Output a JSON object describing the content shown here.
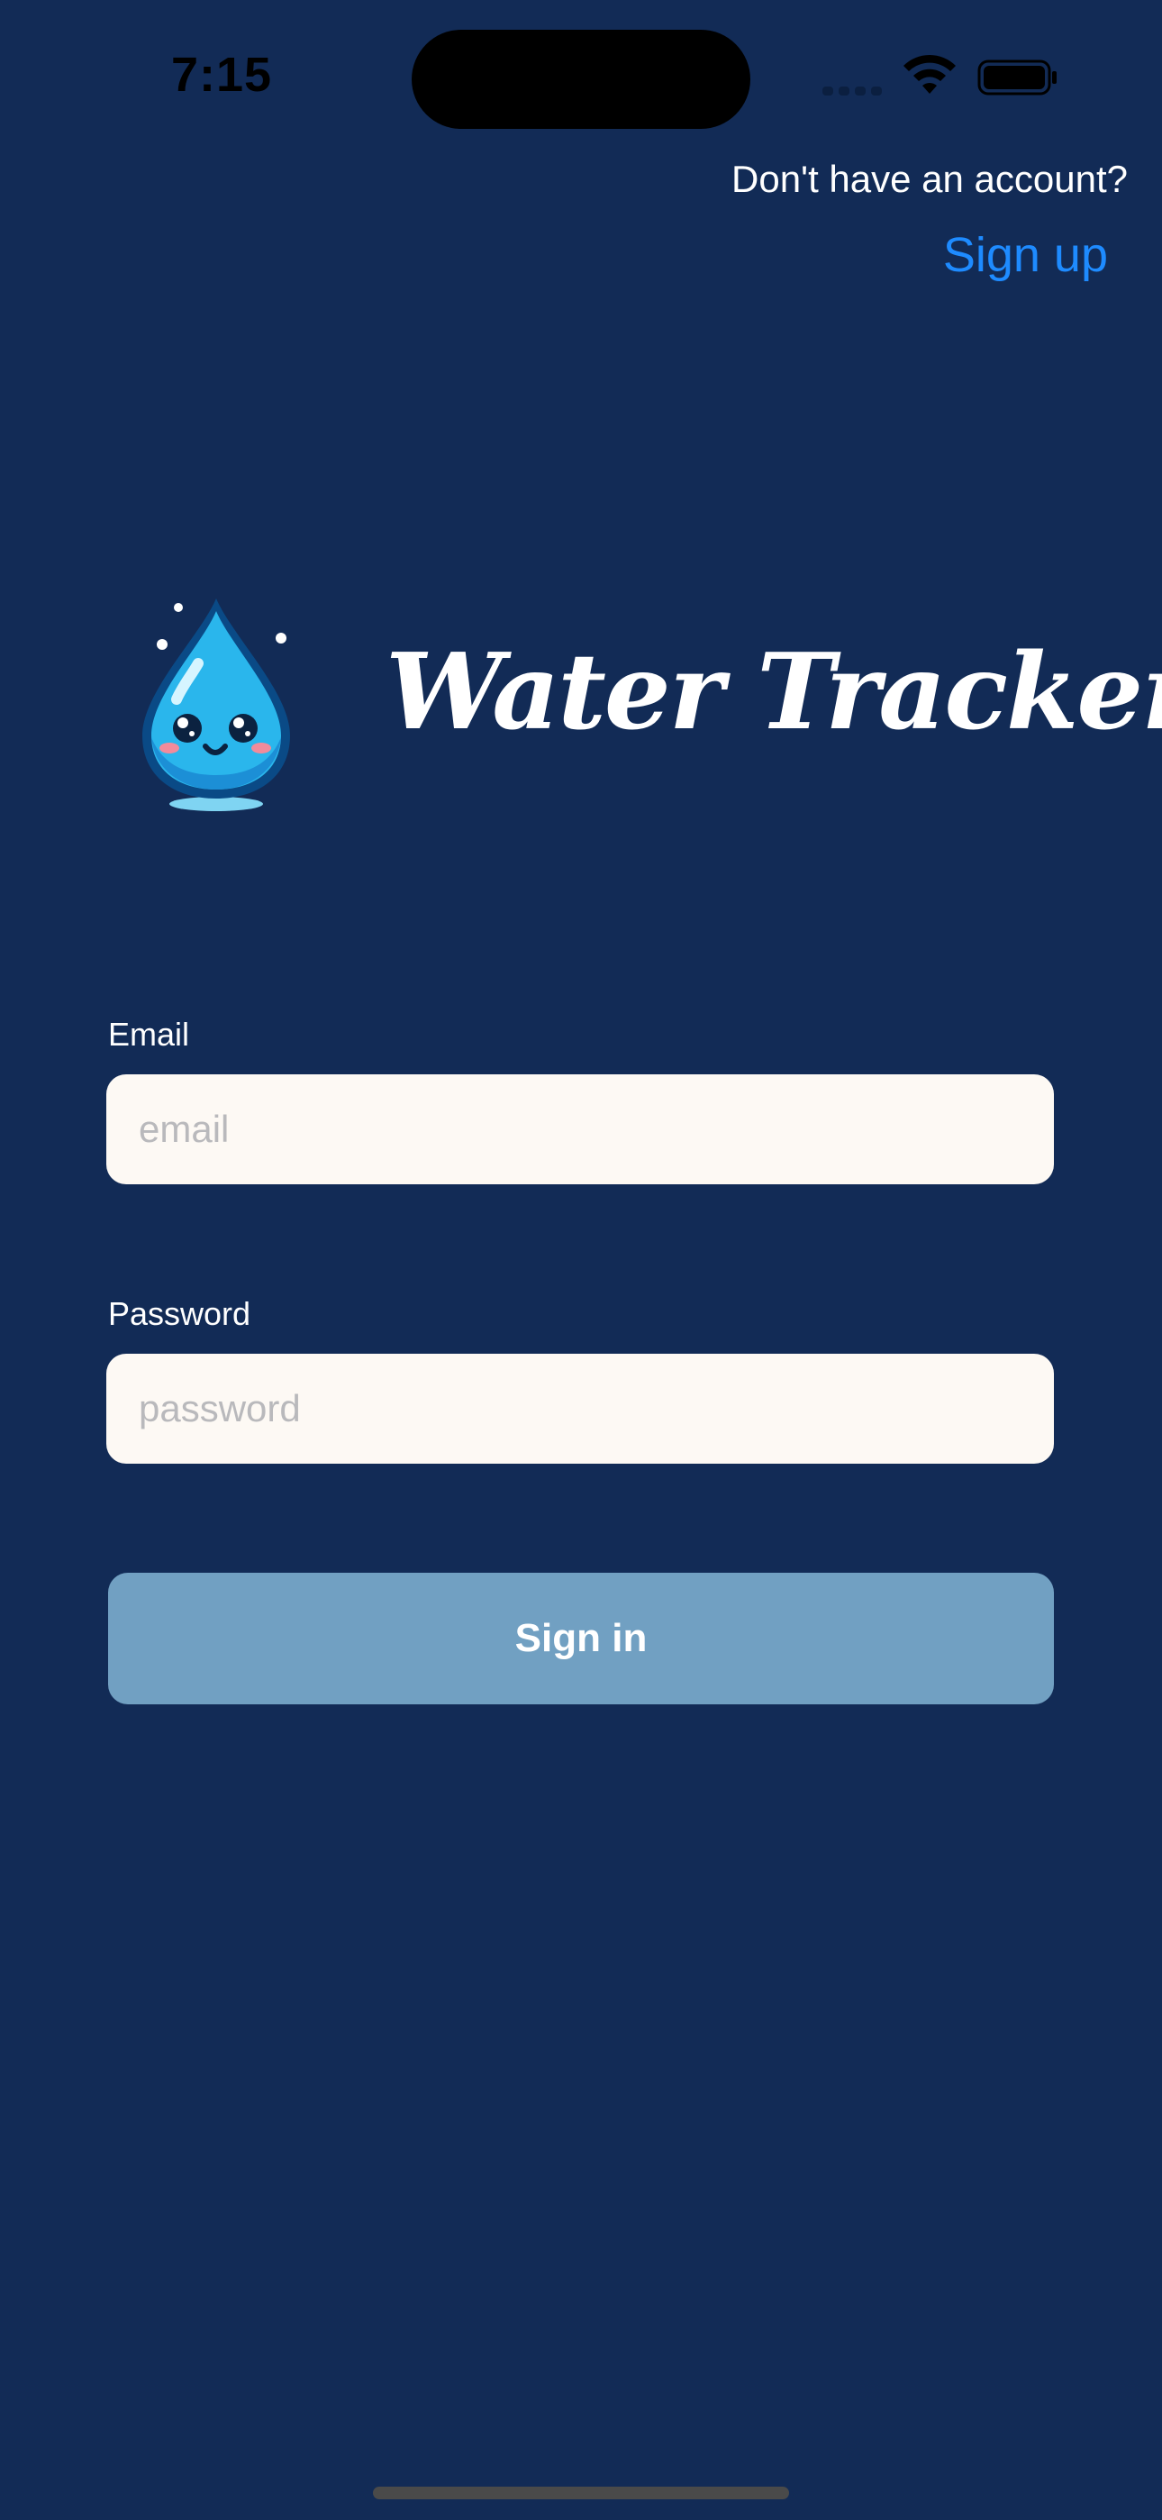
{
  "status_bar": {
    "time": "7:15"
  },
  "signup": {
    "prompt": "Don't have an account?",
    "link_label": "Sign up"
  },
  "app": {
    "title": "Water Tracker",
    "logo_icon": "water-drop-mascot-icon"
  },
  "form": {
    "email": {
      "label": "Email",
      "placeholder": "email",
      "value": ""
    },
    "password": {
      "label": "Password",
      "placeholder": "password",
      "value": ""
    },
    "submit_label": "Sign in"
  },
  "colors": {
    "background": "#122b56",
    "link": "#1e8bff",
    "input_background": "#fdf9f4",
    "button_background": "#71a0c2"
  }
}
